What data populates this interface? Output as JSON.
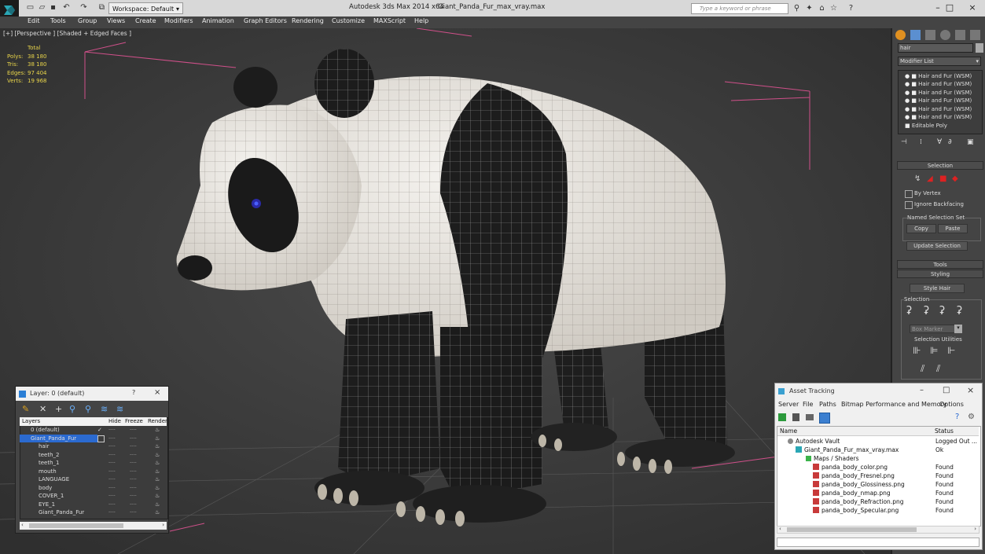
{
  "app": {
    "title": "Autodesk 3ds Max  2014 x64",
    "file": "Giant_Panda_Fur_max_vray.max",
    "workspace": "Workspace: Default",
    "search_placeholder": "Type a keyword or phrase"
  },
  "menu": [
    "Edit",
    "Tools",
    "Group",
    "Views",
    "Create",
    "Modifiers",
    "Animation",
    "Graph Editors",
    "Rendering",
    "Customize",
    "MAXScript",
    "Help"
  ],
  "viewport": {
    "label": "[+] [Perspective ] [Shaded + Edged Faces ]",
    "stats_header": "Total",
    "stats": [
      {
        "label": "Polys:",
        "value": "38 180"
      },
      {
        "label": "Tris:",
        "value": "38 180"
      },
      {
        "label": "Edges:",
        "value": "97 404"
      },
      {
        "label": "Verts:",
        "value": "19 968"
      }
    ]
  },
  "command_panel": {
    "name_field": "hair",
    "modifier_list": "Modifier List",
    "stack": [
      "Hair and Fur (WSM)",
      "Hair and Fur (WSM)",
      "Hair and Fur (WSM)",
      "Hair and Fur (WSM)",
      "Hair and Fur (WSM)",
      "Hair and Fur (WSM)",
      "Editable Poly"
    ],
    "selection_rollout": "Selection",
    "by_vertex": "By Vertex",
    "ignore_backfacing": "Ignore Backfacing",
    "named_selection_set": "Named Selection Set",
    "copy": "Copy",
    "paste": "Paste",
    "update_selection": "Update Selection",
    "tools_rollout": "Tools",
    "styling_rollout": "Styling",
    "style_hair": "Style Hair",
    "selection_group": "Selection",
    "box_marker": "Box Marker",
    "selection_utilities": "Selection Utilities"
  },
  "layer_dialog": {
    "title": "Layer: 0 (default)",
    "help": "?",
    "columns": [
      "Layers",
      "Hide",
      "Freeze",
      "Render"
    ],
    "rows": [
      "0 (default)",
      "Giant_Panda_Fur",
      "hair",
      "teeth_2",
      "teeth_1",
      "mouth",
      "LANGUAGE",
      "body",
      "COVER_1",
      "EYE_1",
      "Giant_Panda_Fur"
    ],
    "dash": "----"
  },
  "asset_dialog": {
    "title": "Asset Tracking",
    "menu": [
      "Server",
      "File",
      "Paths",
      "Bitmap Performance and Memory",
      "Options"
    ],
    "columns": [
      "Name",
      "Status"
    ],
    "rows": [
      {
        "name": "Autodesk Vault",
        "status": "Logged Out ..."
      },
      {
        "name": "Giant_Panda_Fur_max_vray.max",
        "status": "Ok"
      },
      {
        "name": "Maps / Shaders",
        "status": ""
      },
      {
        "name": "panda_body_color.png",
        "status": "Found"
      },
      {
        "name": "panda_body_Fresnel.png",
        "status": "Found"
      },
      {
        "name": "panda_body_Glossiness.png",
        "status": "Found"
      },
      {
        "name": "panda_body_nmap.png",
        "status": "Found"
      },
      {
        "name": "panda_body_Refraction.png",
        "status": "Found"
      },
      {
        "name": "panda_body_Specular.png",
        "status": "Found"
      }
    ]
  }
}
